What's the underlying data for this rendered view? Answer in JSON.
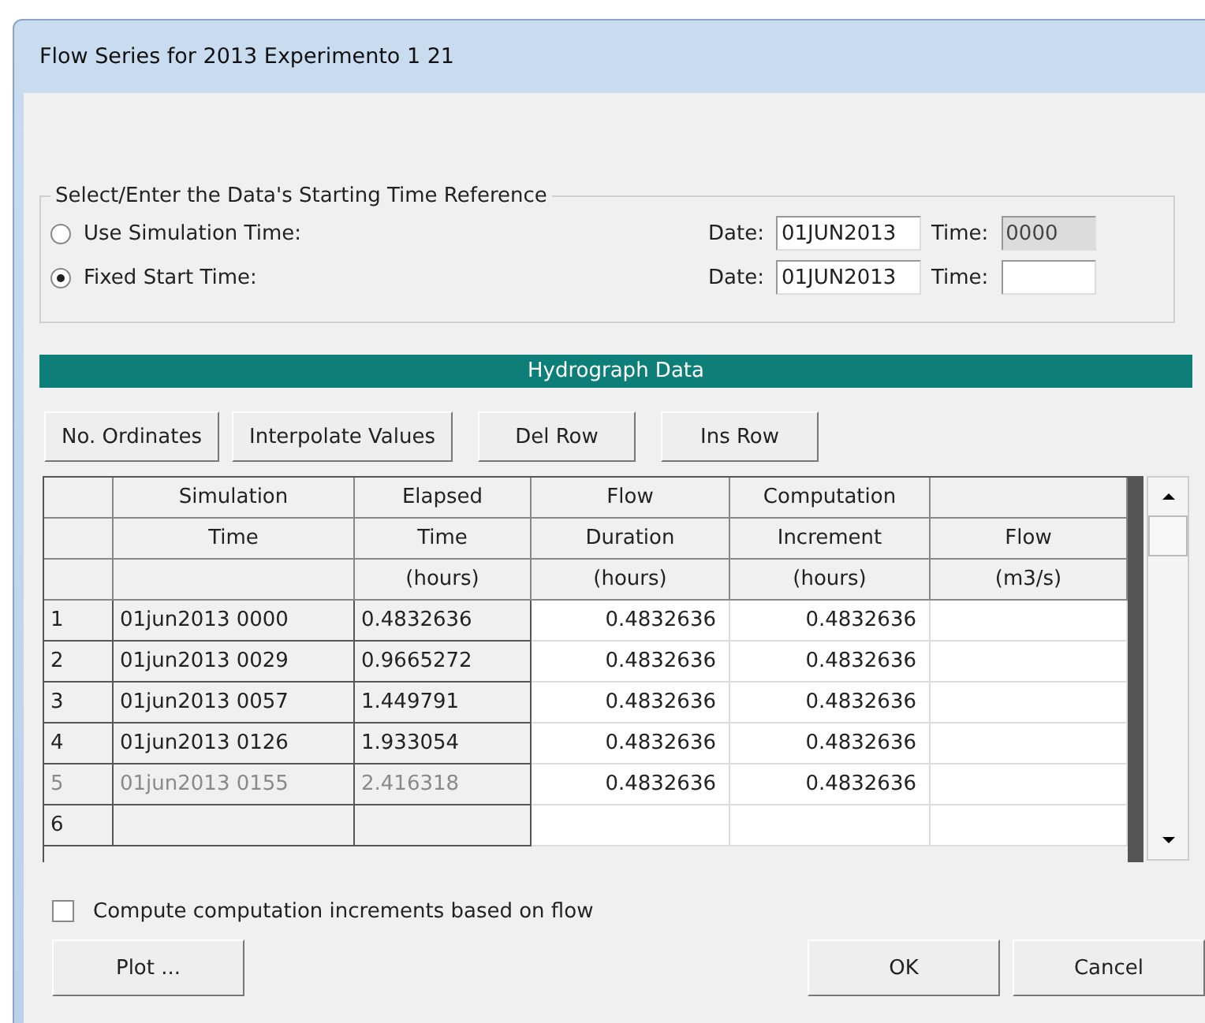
{
  "window": {
    "title": "Flow Series for 2013 Experimento 1 21"
  },
  "time_reference": {
    "legend": "Select/Enter the Data's Starting Time Reference",
    "options": [
      {
        "label": "Use Simulation Time:",
        "selected": false,
        "date_label": "Date:",
        "date": "01JUN2013",
        "time_label": "Time:",
        "time": "0000",
        "disabled": true
      },
      {
        "label": "Fixed Start Time:",
        "selected": true,
        "date_label": "Date:",
        "date": "01JUN2013",
        "time_label": "Time:",
        "disabled": false
      }
    ]
  },
  "section_title": "Hydrograph Data",
  "toolbar": [
    "No. Ordinates",
    "Interpolate Values",
    "Del Row",
    "Ins Row"
  ],
  "table": {
    "columns": [
      {
        "editable": false
      },
      {
        "top": "Simulation",
        "middle": "Time",
        "editable": false
      },
      {
        "top": "Elapsed",
        "middle": "Time",
        "bottom": "(hours)",
        "editable": false
      },
      {
        "top": "Flow",
        "middle": "Duration",
        "bottom": "(hours)",
        "editable": true
      },
      {
        "top": "Computation",
        "middle": "Increment",
        "bottom": "(hours)",
        "editable": true
      },
      {
        "middle": "Flow",
        "bottom": "(m3/s)",
        "editable": true
      }
    ],
    "rows": [
      {
        "cells": [
          "1",
          "01jun2013 0000",
          "0.4832636",
          "0.4832636",
          "0.4832636",
          null
        ],
        "dim": false
      },
      {
        "cells": [
          "2",
          "01jun2013 0029",
          "0.9665272",
          "0.4832636",
          "0.4832636",
          null
        ],
        "dim": false
      },
      {
        "cells": [
          "3",
          "01jun2013 0057",
          "1.449791",
          "0.4832636",
          "0.4832636",
          null
        ],
        "dim": false
      },
      {
        "cells": [
          "4",
          "01jun2013 0126",
          "1.933054",
          "0.4832636",
          "0.4832636",
          null
        ],
        "dim": false
      },
      {
        "cells": [
          "5",
          "01jun2013 0155",
          "2.416318",
          "0.4832636",
          "0.4832636",
          null
        ],
        "dim": true
      },
      {
        "cells": [
          "6",
          null,
          null,
          null,
          null,
          null
        ],
        "dim": false
      }
    ]
  },
  "checkbox": {
    "label": "Compute computation increments based on flow",
    "checked": false
  },
  "buttons": {
    "left": [
      "Plot ..."
    ],
    "right": [
      "OK",
      "Cancel"
    ]
  }
}
